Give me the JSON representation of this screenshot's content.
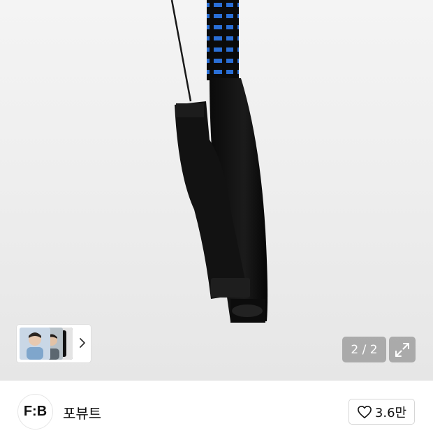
{
  "gallery": {
    "counter": "2 / 2",
    "expand_icon": "expand-icon",
    "thumbnails_next_icon": "chevron-right-icon"
  },
  "brand": {
    "logo_text": "F:B",
    "name": "포뷰트"
  },
  "like": {
    "icon": "heart-icon",
    "count": "3.6만"
  }
}
